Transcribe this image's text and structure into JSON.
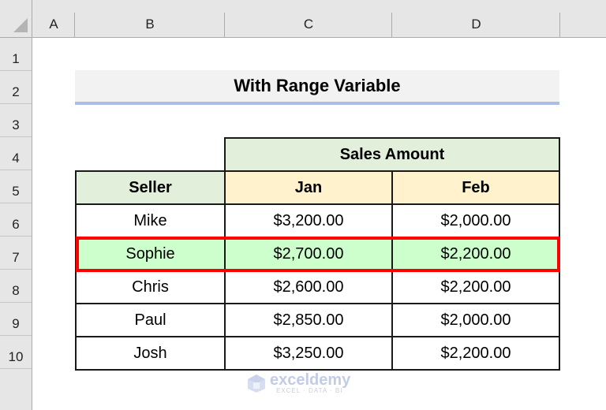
{
  "columns": [
    "A",
    "B",
    "C",
    "D"
  ],
  "rows": [
    "1",
    "2",
    "3",
    "4",
    "5",
    "6",
    "7",
    "8",
    "9",
    "10"
  ],
  "title": "With Range Variable",
  "table": {
    "group_header": "Sales Amount",
    "headers": [
      "Seller",
      "Jan",
      "Feb"
    ],
    "data": [
      {
        "seller": "Mike",
        "jan": "$3,200.00",
        "feb": "$2,000.00"
      },
      {
        "seller": "Sophie",
        "jan": "$2,700.00",
        "feb": "$2,200.00"
      },
      {
        "seller": "Chris",
        "jan": "$2,600.00",
        "feb": "$2,200.00"
      },
      {
        "seller": "Paul",
        "jan": "$2,850.00",
        "feb": "$2,000.00"
      },
      {
        "seller": "Josh",
        "jan": "$3,250.00",
        "feb": "$2,200.00"
      }
    ],
    "highlighted_row": "Sophie"
  },
  "colors": {
    "group_header_bg": "#e2efda",
    "month_header_bg": "#fff2cc",
    "highlight_bg": "#ccffcc",
    "highlight_border": "#ff0000",
    "title_underline": "#a9bde6"
  },
  "watermark": {
    "brand": "exceldemy",
    "tagline": "EXCEL · DATA · BI"
  }
}
